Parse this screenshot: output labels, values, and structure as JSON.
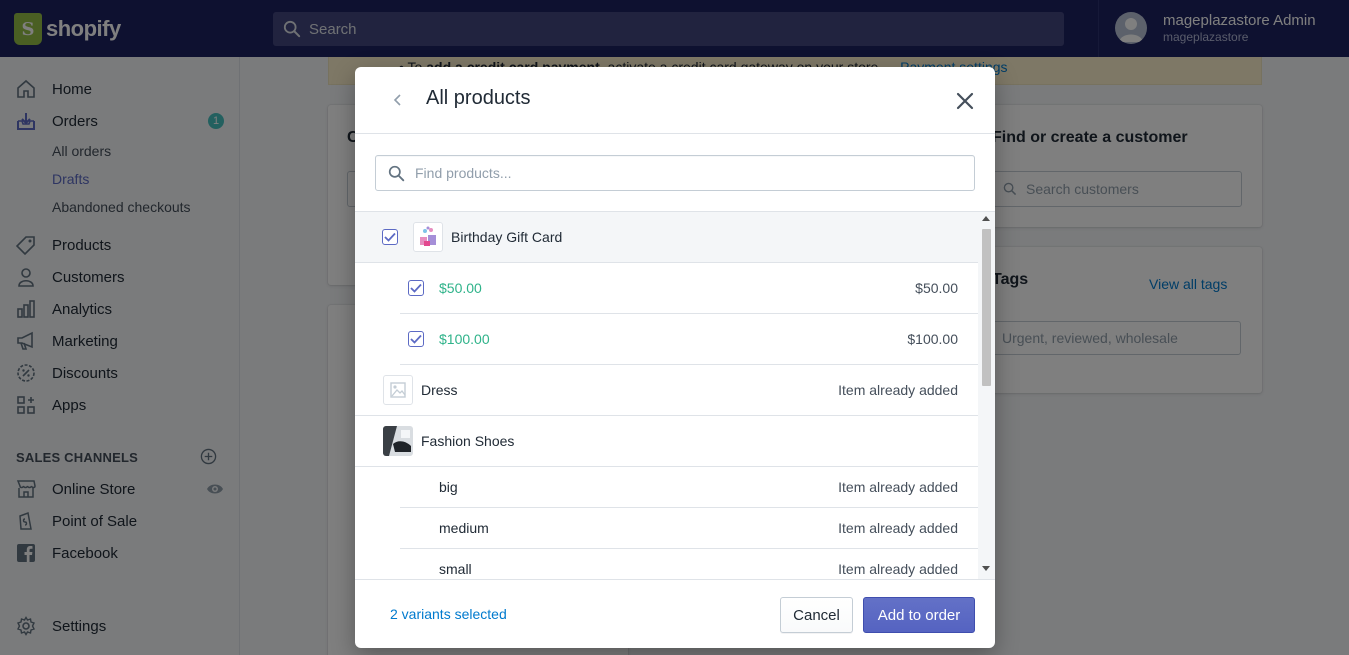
{
  "topbar": {
    "logo_text": "shopify",
    "logo_letter": "S",
    "search_placeholder": "Search",
    "user_name": "mageplazastore Admin",
    "user_store": "mageplazastore"
  },
  "sidebar": {
    "items": [
      {
        "label": "Home",
        "icon": "home-icon"
      },
      {
        "label": "Orders",
        "icon": "orders-icon",
        "badge": "1"
      },
      {
        "label": "Products",
        "icon": "tag-icon"
      },
      {
        "label": "Customers",
        "icon": "customer-icon"
      },
      {
        "label": "Analytics",
        "icon": "analytics-icon"
      },
      {
        "label": "Marketing",
        "icon": "megaphone-icon"
      },
      {
        "label": "Discounts",
        "icon": "discount-icon"
      },
      {
        "label": "Apps",
        "icon": "apps-icon"
      }
    ],
    "order_subitems": [
      "All orders",
      "Drafts",
      "Abandoned checkouts"
    ],
    "active_subitem": "Drafts",
    "channels_title": "SALES CHANNELS",
    "channels": [
      {
        "label": "Online Store",
        "icon": "store-icon"
      },
      {
        "label": "Point of Sale",
        "icon": "pos-icon"
      },
      {
        "label": "Facebook",
        "icon": "facebook-icon"
      }
    ],
    "settings_label": "Settings"
  },
  "background": {
    "banner_prefix": "To ",
    "banner_bold": "add a credit card payment",
    "banner_middle": ", activate a credit card gateway on your store — ",
    "banner_link": "Payment settings",
    "customer_title": "Find or create a customer",
    "customer_placeholder": "Search customers",
    "tags_title": "Tags",
    "tags_link": "View all tags",
    "tags_placeholder": "Urgent, reviewed, wholesale",
    "left_card_title_initial": "C"
  },
  "modal": {
    "title": "All products",
    "search_placeholder": "Find products...",
    "rows": [
      {
        "kind": "product",
        "label": "Birthday Gift Card",
        "checked": true,
        "right": ""
      },
      {
        "kind": "variant",
        "label": "$50.00",
        "checked": true,
        "right": "$50.00"
      },
      {
        "kind": "variant",
        "label": "$100.00",
        "checked": true,
        "right": "$100.00"
      },
      {
        "kind": "product",
        "label": "Dress",
        "checked": false,
        "right": "Item already added"
      },
      {
        "kind": "product",
        "label": "Fashion Shoes",
        "checked": false,
        "right": ""
      },
      {
        "kind": "variant",
        "label": "big",
        "checked": false,
        "right": "Item already added"
      },
      {
        "kind": "variant",
        "label": "medium",
        "checked": false,
        "right": "Item already added"
      },
      {
        "kind": "variant",
        "label": "small",
        "checked": false,
        "right": "Item already added"
      }
    ],
    "selected_count": "2 variants selected",
    "cancel_label": "Cancel",
    "add_label": "Add to order"
  },
  "colors": {
    "topbar": "#1c2260",
    "accent": "#5c6ac4",
    "link": "#007ace",
    "variant_green": "#2fb38a",
    "badge": "#47c1bf"
  }
}
